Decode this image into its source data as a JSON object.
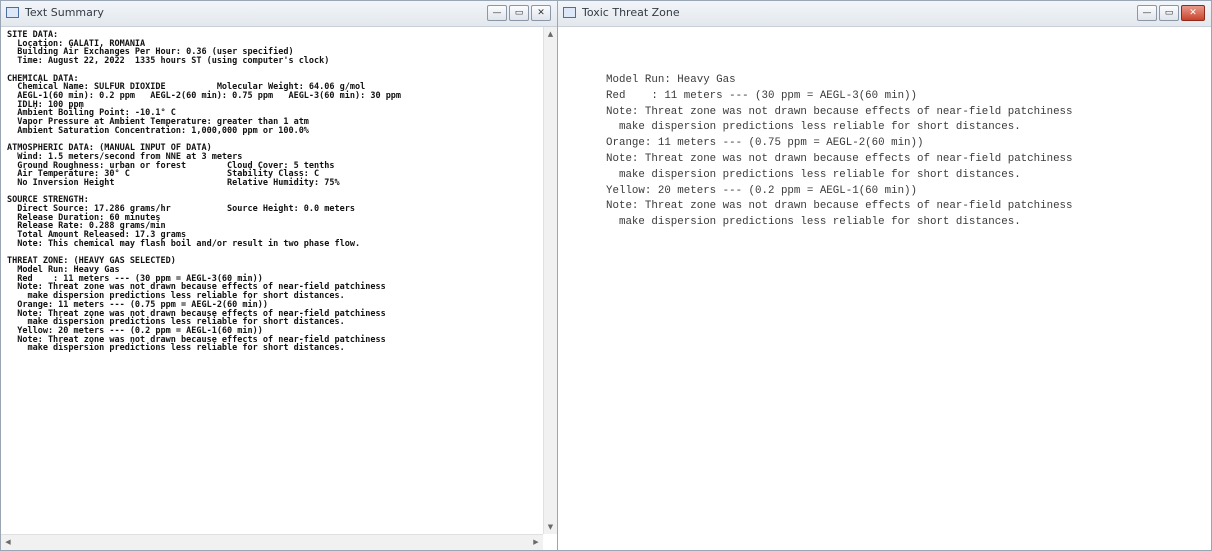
{
  "summary_window": {
    "title": "Text Summary",
    "controls": {
      "minimize": "—",
      "maximize": "▭",
      "close": "✕"
    },
    "lines": [
      "SITE DATA:",
      "  Location: GALATI, ROMANIA",
      "  Building Air Exchanges Per Hour: 0.36 (user specified)",
      "  Time: August 22, 2022  1335 hours ST (using computer's clock)",
      "",
      "CHEMICAL DATA:",
      "  Chemical Name: SULFUR DIOXIDE          Molecular Weight: 64.06 g/mol",
      "  AEGL-1(60 min): 0.2 ppm   AEGL-2(60 min): 0.75 ppm   AEGL-3(60 min): 30 ppm",
      "  IDLH: 100 ppm",
      "  Ambient Boiling Point: -10.1° C",
      "  Vapor Pressure at Ambient Temperature: greater than 1 atm",
      "  Ambient Saturation Concentration: 1,000,000 ppm or 100.0%",
      "",
      "ATMOSPHERIC DATA: (MANUAL INPUT OF DATA)",
      "  Wind: 1.5 meters/second from NNE at 3 meters",
      "  Ground Roughness: urban or forest        Cloud Cover: 5 tenths",
      "  Air Temperature: 30° C                   Stability Class: C",
      "  No Inversion Height                      Relative Humidity: 75%",
      "",
      "SOURCE STRENGTH:",
      "  Direct Source: 17.286 grams/hr           Source Height: 0.0 meters",
      "  Release Duration: 60 minutes",
      "  Release Rate: 0.288 grams/min",
      "  Total Amount Released: 17.3 grams",
      "  Note: This chemical may flash boil and/or result in two phase flow.",
      "",
      "THREAT ZONE: (HEAVY GAS SELECTED)",
      "  Model Run: Heavy Gas",
      "  Red    : 11 meters --- (30 ppm = AEGL-3(60 min))",
      "  Note: Threat zone was not drawn because effects of near-field patchiness",
      "    make dispersion predictions less reliable for short distances.",
      "  Orange: 11 meters --- (0.75 ppm = AEGL-2(60 min))",
      "  Note: Threat zone was not drawn because effects of near-field patchiness",
      "    make dispersion predictions less reliable for short distances.",
      "  Yellow: 20 meters --- (0.2 ppm = AEGL-1(60 min))",
      "  Note: Threat zone was not drawn because effects of near-field patchiness",
      "    make dispersion predictions less reliable for short distances."
    ]
  },
  "threat_window": {
    "title": "Toxic Threat Zone",
    "controls": {
      "minimize": "—",
      "maximize": "▭",
      "close": "✕"
    },
    "lines": [
      "Model Run: Heavy Gas",
      "Red    : 11 meters --- (30 ppm = AEGL-3(60 min))",
      "Note: Threat zone was not drawn because effects of near-field patchiness",
      "  make dispersion predictions less reliable for short distances.",
      "Orange: 11 meters --- (0.75 ppm = AEGL-2(60 min))",
      "Note: Threat zone was not drawn because effects of near-field patchiness",
      "  make dispersion predictions less reliable for short distances.",
      "Yellow: 20 meters --- (0.2 ppm = AEGL-1(60 min))",
      "Note: Threat zone was not drawn because effects of near-field patchiness",
      "  make dispersion predictions less reliable for short distances."
    ]
  }
}
